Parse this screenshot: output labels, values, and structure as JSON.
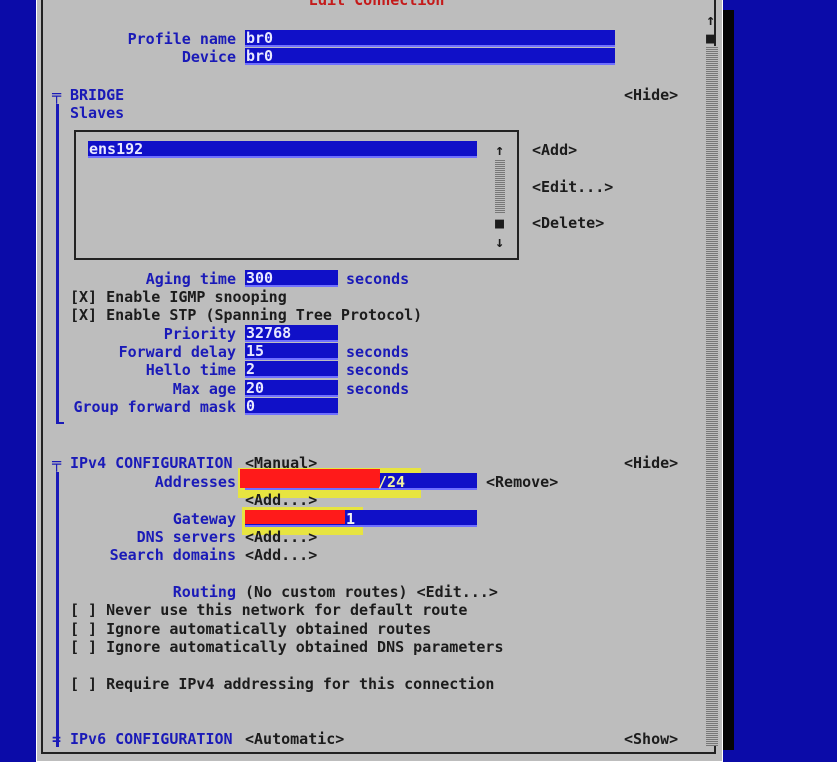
{
  "dialog_title": "Edit Connection",
  "profile": {
    "name_label": "Profile name",
    "name_value": "br0",
    "device_label": "Device",
    "device_value": "br0"
  },
  "bridge": {
    "section_label": "BRIDGE",
    "hide_label": "<Hide>",
    "slaves_label": "Slaves",
    "slaves_list": [
      "ens192"
    ],
    "add_label": "<Add>",
    "edit_label": "<Edit...>",
    "delete_label": "<Delete>",
    "aging_time_label": "Aging time",
    "aging_time_value": "300",
    "igmp_checkbox": "[X] Enable IGMP snooping",
    "stp_checkbox": "[X] Enable STP (Spanning Tree Protocol)",
    "priority_label": "Priority",
    "priority_value": "32768",
    "forward_delay_label": "Forward delay",
    "forward_delay_value": "15",
    "hello_time_label": "Hello time",
    "hello_time_value": "2",
    "max_age_label": "Max age",
    "max_age_value": "20",
    "group_forward_mask_label": "Group forward mask",
    "group_forward_mask_value": "0",
    "seconds_unit": "seconds"
  },
  "ipv4": {
    "section_label": "IPv4 CONFIGURATION",
    "mode": "<Manual>",
    "hide_label": "<Hide>",
    "addresses_label": "Addresses",
    "address_suffix": "/24",
    "remove_label": "<Remove>",
    "add_label": "<Add...>",
    "gateway_label": "Gateway",
    "gateway_suffix": "1",
    "dns_label": "DNS servers",
    "search_domains_label": "Search domains",
    "routing_label": "Routing",
    "routing_value": "(No custom routes) <Edit...>",
    "never_default_checkbox": "[ ] Never use this network for default route",
    "ignore_routes_checkbox": "[ ] Ignore automatically obtained routes",
    "ignore_dns_checkbox": "[ ] Ignore automatically obtained DNS parameters",
    "require_ipv4_checkbox": "[ ] Require IPv4 addressing for this connection"
  },
  "ipv6": {
    "marker": "=",
    "section_label": "IPv6 CONFIGURATION",
    "mode": "<Automatic>",
    "show_label": "<Show>"
  },
  "scroll_arrows": {
    "up": "↑",
    "down": "↓",
    "thumb": "■"
  },
  "section_marker": "╤"
}
